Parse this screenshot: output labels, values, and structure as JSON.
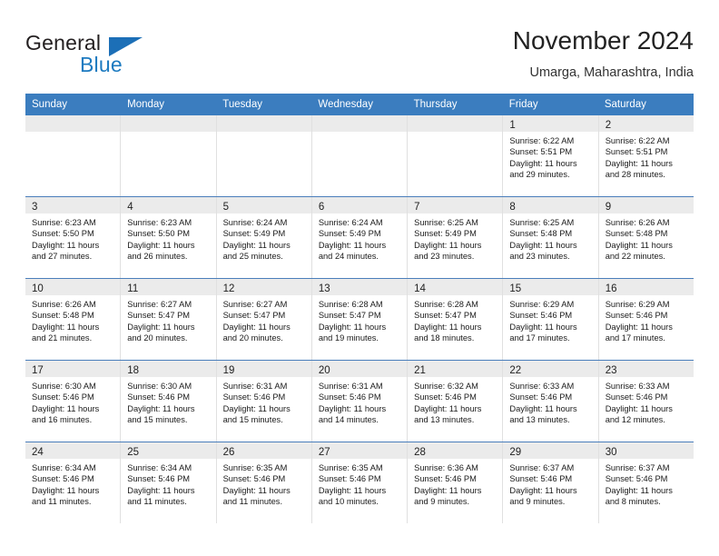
{
  "brand": {
    "name_part1": "General",
    "name_part2": "Blue",
    "accent_color": "#1c7ac0",
    "triangle_color": "#1c6fb7"
  },
  "header": {
    "title": "November 2024",
    "subtitle": "Umarga, Maharashtra, India"
  },
  "calendar": {
    "header_bg": "#3b7dbf",
    "daynum_band_bg": "#ebebeb",
    "weekdays": [
      "Sunday",
      "Monday",
      "Tuesday",
      "Wednesday",
      "Thursday",
      "Friday",
      "Saturday"
    ],
    "weeks": [
      [
        {
          "empty": true
        },
        {
          "empty": true
        },
        {
          "empty": true
        },
        {
          "empty": true
        },
        {
          "empty": true
        },
        {
          "day": "1",
          "sunrise": "Sunrise: 6:22 AM",
          "sunset": "Sunset: 5:51 PM",
          "daylight1": "Daylight: 11 hours",
          "daylight2": "and 29 minutes."
        },
        {
          "day": "2",
          "sunrise": "Sunrise: 6:22 AM",
          "sunset": "Sunset: 5:51 PM",
          "daylight1": "Daylight: 11 hours",
          "daylight2": "and 28 minutes."
        }
      ],
      [
        {
          "day": "3",
          "sunrise": "Sunrise: 6:23 AM",
          "sunset": "Sunset: 5:50 PM",
          "daylight1": "Daylight: 11 hours",
          "daylight2": "and 27 minutes."
        },
        {
          "day": "4",
          "sunrise": "Sunrise: 6:23 AM",
          "sunset": "Sunset: 5:50 PM",
          "daylight1": "Daylight: 11 hours",
          "daylight2": "and 26 minutes."
        },
        {
          "day": "5",
          "sunrise": "Sunrise: 6:24 AM",
          "sunset": "Sunset: 5:49 PM",
          "daylight1": "Daylight: 11 hours",
          "daylight2": "and 25 minutes."
        },
        {
          "day": "6",
          "sunrise": "Sunrise: 6:24 AM",
          "sunset": "Sunset: 5:49 PM",
          "daylight1": "Daylight: 11 hours",
          "daylight2": "and 24 minutes."
        },
        {
          "day": "7",
          "sunrise": "Sunrise: 6:25 AM",
          "sunset": "Sunset: 5:49 PM",
          "daylight1": "Daylight: 11 hours",
          "daylight2": "and 23 minutes."
        },
        {
          "day": "8",
          "sunrise": "Sunrise: 6:25 AM",
          "sunset": "Sunset: 5:48 PM",
          "daylight1": "Daylight: 11 hours",
          "daylight2": "and 23 minutes."
        },
        {
          "day": "9",
          "sunrise": "Sunrise: 6:26 AM",
          "sunset": "Sunset: 5:48 PM",
          "daylight1": "Daylight: 11 hours",
          "daylight2": "and 22 minutes."
        }
      ],
      [
        {
          "day": "10",
          "sunrise": "Sunrise: 6:26 AM",
          "sunset": "Sunset: 5:48 PM",
          "daylight1": "Daylight: 11 hours",
          "daylight2": "and 21 minutes."
        },
        {
          "day": "11",
          "sunrise": "Sunrise: 6:27 AM",
          "sunset": "Sunset: 5:47 PM",
          "daylight1": "Daylight: 11 hours",
          "daylight2": "and 20 minutes."
        },
        {
          "day": "12",
          "sunrise": "Sunrise: 6:27 AM",
          "sunset": "Sunset: 5:47 PM",
          "daylight1": "Daylight: 11 hours",
          "daylight2": "and 20 minutes."
        },
        {
          "day": "13",
          "sunrise": "Sunrise: 6:28 AM",
          "sunset": "Sunset: 5:47 PM",
          "daylight1": "Daylight: 11 hours",
          "daylight2": "and 19 minutes."
        },
        {
          "day": "14",
          "sunrise": "Sunrise: 6:28 AM",
          "sunset": "Sunset: 5:47 PM",
          "daylight1": "Daylight: 11 hours",
          "daylight2": "and 18 minutes."
        },
        {
          "day": "15",
          "sunrise": "Sunrise: 6:29 AM",
          "sunset": "Sunset: 5:46 PM",
          "daylight1": "Daylight: 11 hours",
          "daylight2": "and 17 minutes."
        },
        {
          "day": "16",
          "sunrise": "Sunrise: 6:29 AM",
          "sunset": "Sunset: 5:46 PM",
          "daylight1": "Daylight: 11 hours",
          "daylight2": "and 17 minutes."
        }
      ],
      [
        {
          "day": "17",
          "sunrise": "Sunrise: 6:30 AM",
          "sunset": "Sunset: 5:46 PM",
          "daylight1": "Daylight: 11 hours",
          "daylight2": "and 16 minutes."
        },
        {
          "day": "18",
          "sunrise": "Sunrise: 6:30 AM",
          "sunset": "Sunset: 5:46 PM",
          "daylight1": "Daylight: 11 hours",
          "daylight2": "and 15 minutes."
        },
        {
          "day": "19",
          "sunrise": "Sunrise: 6:31 AM",
          "sunset": "Sunset: 5:46 PM",
          "daylight1": "Daylight: 11 hours",
          "daylight2": "and 15 minutes."
        },
        {
          "day": "20",
          "sunrise": "Sunrise: 6:31 AM",
          "sunset": "Sunset: 5:46 PM",
          "daylight1": "Daylight: 11 hours",
          "daylight2": "and 14 minutes."
        },
        {
          "day": "21",
          "sunrise": "Sunrise: 6:32 AM",
          "sunset": "Sunset: 5:46 PM",
          "daylight1": "Daylight: 11 hours",
          "daylight2": "and 13 minutes."
        },
        {
          "day": "22",
          "sunrise": "Sunrise: 6:33 AM",
          "sunset": "Sunset: 5:46 PM",
          "daylight1": "Daylight: 11 hours",
          "daylight2": "and 13 minutes."
        },
        {
          "day": "23",
          "sunrise": "Sunrise: 6:33 AM",
          "sunset": "Sunset: 5:46 PM",
          "daylight1": "Daylight: 11 hours",
          "daylight2": "and 12 minutes."
        }
      ],
      [
        {
          "day": "24",
          "sunrise": "Sunrise: 6:34 AM",
          "sunset": "Sunset: 5:46 PM",
          "daylight1": "Daylight: 11 hours",
          "daylight2": "and 11 minutes."
        },
        {
          "day": "25",
          "sunrise": "Sunrise: 6:34 AM",
          "sunset": "Sunset: 5:46 PM",
          "daylight1": "Daylight: 11 hours",
          "daylight2": "and 11 minutes."
        },
        {
          "day": "26",
          "sunrise": "Sunrise: 6:35 AM",
          "sunset": "Sunset: 5:46 PM",
          "daylight1": "Daylight: 11 hours",
          "daylight2": "and 11 minutes."
        },
        {
          "day": "27",
          "sunrise": "Sunrise: 6:35 AM",
          "sunset": "Sunset: 5:46 PM",
          "daylight1": "Daylight: 11 hours",
          "daylight2": "and 10 minutes."
        },
        {
          "day": "28",
          "sunrise": "Sunrise: 6:36 AM",
          "sunset": "Sunset: 5:46 PM",
          "daylight1": "Daylight: 11 hours",
          "daylight2": "and 9 minutes."
        },
        {
          "day": "29",
          "sunrise": "Sunrise: 6:37 AM",
          "sunset": "Sunset: 5:46 PM",
          "daylight1": "Daylight: 11 hours",
          "daylight2": "and 9 minutes."
        },
        {
          "day": "30",
          "sunrise": "Sunrise: 6:37 AM",
          "sunset": "Sunset: 5:46 PM",
          "daylight1": "Daylight: 11 hours",
          "daylight2": "and 8 minutes."
        }
      ]
    ]
  }
}
